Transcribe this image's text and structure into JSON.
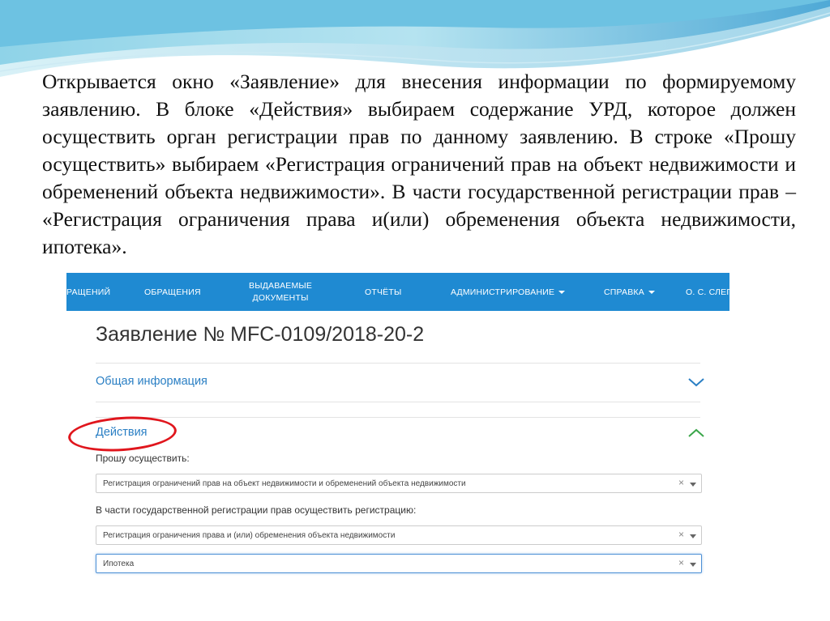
{
  "slide": {
    "paragraph": "Открывается окно «Заявление» для внесения информации по формируемому заявлению. В блоке «Действия» выбираем содержание УРД, которое должен осуществить орган регистрации прав по данному заявлению. В строке «Прошу осуществить» выбираем «Регистрация ограничений прав на объект недвижимости и обременений объекта недвижимости». В части государственной регистрации прав – «Регистрация ограничения права и(или) обременения объекта недвижимости, ипотека»."
  },
  "navbar": {
    "items": [
      {
        "label": "РАЩЕНИЙ"
      },
      {
        "label": "ОБРАЩЕНИЯ"
      },
      {
        "label_line1": "ВЫДАВАЕМЫЕ",
        "label_line2": "ДОКУМЕНТЫ"
      },
      {
        "label": "ОТЧЁТЫ"
      },
      {
        "label": "АДМИНИСТРИРОВАНИЕ"
      },
      {
        "label": "СПРАВКА"
      },
      {
        "label": "О. С. СЛЕПО"
      }
    ]
  },
  "form": {
    "title": "Заявление № MFC-0109/2018-20-2",
    "sections": {
      "general": {
        "label": "Общая информация"
      },
      "actions": {
        "label": "Действия"
      }
    },
    "fields": [
      {
        "label": "Прошу осуществить:",
        "value": "Регистрация ограничений прав на объект недвижимости и обременений объекта недвижимости",
        "clear": "×"
      },
      {
        "label": "В части государственной регистрации прав осуществить регистрацию:",
        "value": "Регистрация ограничения права и (или) обременения объекта недвижимости",
        "clear": "×"
      },
      {
        "label": "",
        "value": "Ипотека",
        "clear": "×"
      }
    ]
  },
  "colors": {
    "navbar": "#1f8ad2",
    "link": "#2a7fc4",
    "chevron_up": "#3aa64a",
    "chevron_down": "#2a7fc4",
    "annotation": "#e0161d"
  },
  "icons": [
    "chevron-down-icon",
    "chevron-up-icon",
    "caret-down-icon",
    "clear-icon"
  ]
}
